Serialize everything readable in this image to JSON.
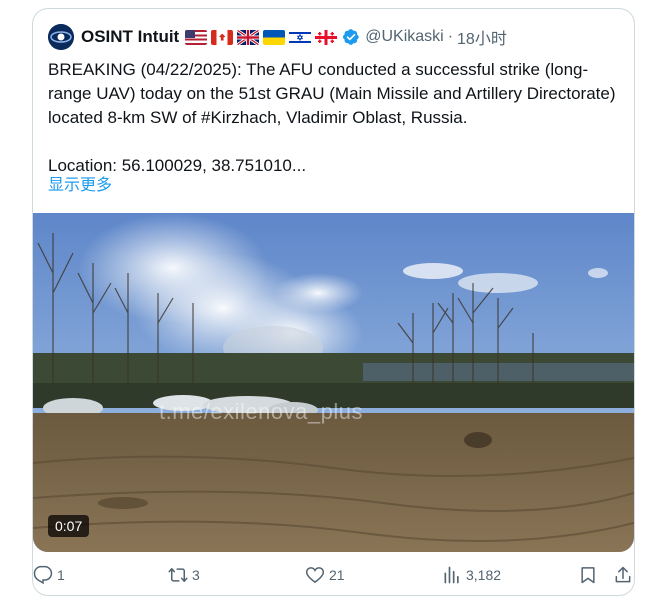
{
  "post": {
    "author": {
      "name": "OSINT Intuit",
      "handle": "@UKikaski",
      "time": "18小时",
      "separator": "·",
      "flags": [
        "us-flag",
        "canada-flag",
        "uk-flag",
        "ukraine-flag",
        "israel-flag",
        "georgia-flag"
      ],
      "verified": true
    },
    "text": "BREAKING (04/22/2025): The AFU conducted a successful strike (long-range UAV) today on the 51st GRAU (Main Missile and Artillery Directorate) located 8-km SW of #Kirzhach, Vladimir Oblast, Russia.\n\nLocation: 56.100029, 38.751010...",
    "show_more": "显示更多"
  },
  "video": {
    "duration": "0:07",
    "watermark": "t.me/exilenova_plus"
  },
  "actions": {
    "replies": "1",
    "reposts": "3",
    "likes": "21",
    "views": "3,182"
  },
  "colors": {
    "accent": "#1d9bf0",
    "muted": "#536471",
    "border": "#cfd9de"
  }
}
